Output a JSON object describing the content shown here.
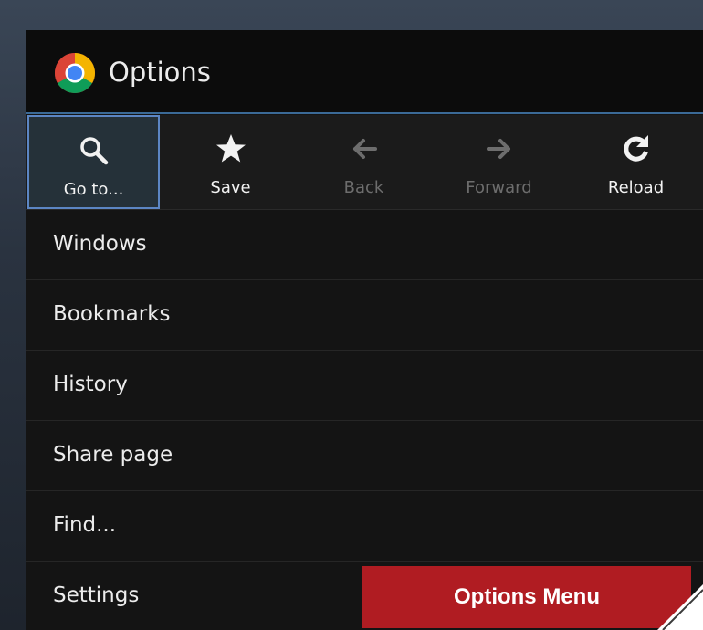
{
  "dialog": {
    "title": "Options",
    "logo_icon": "chrome-logo-icon"
  },
  "toolbar": {
    "items": [
      {
        "label": "Go to...",
        "icon": "search-icon",
        "state": "selected"
      },
      {
        "label": "Save",
        "icon": "star-icon",
        "state": "enabled"
      },
      {
        "label": "Back",
        "icon": "arrow-left-icon",
        "state": "disabled"
      },
      {
        "label": "Forward",
        "icon": "arrow-right-icon",
        "state": "disabled"
      },
      {
        "label": "Reload",
        "icon": "reload-icon",
        "state": "enabled"
      }
    ]
  },
  "menu": {
    "items": [
      {
        "label": "Windows"
      },
      {
        "label": "Bookmarks"
      },
      {
        "label": "History"
      },
      {
        "label": "Share page"
      },
      {
        "label": "Find..."
      },
      {
        "label": "Settings"
      }
    ]
  },
  "caption": {
    "text": "Options Menu"
  },
  "colors": {
    "accent_border": "#5c86c4",
    "caption_bg": "#b01c22",
    "panel_bg": "#141414"
  }
}
